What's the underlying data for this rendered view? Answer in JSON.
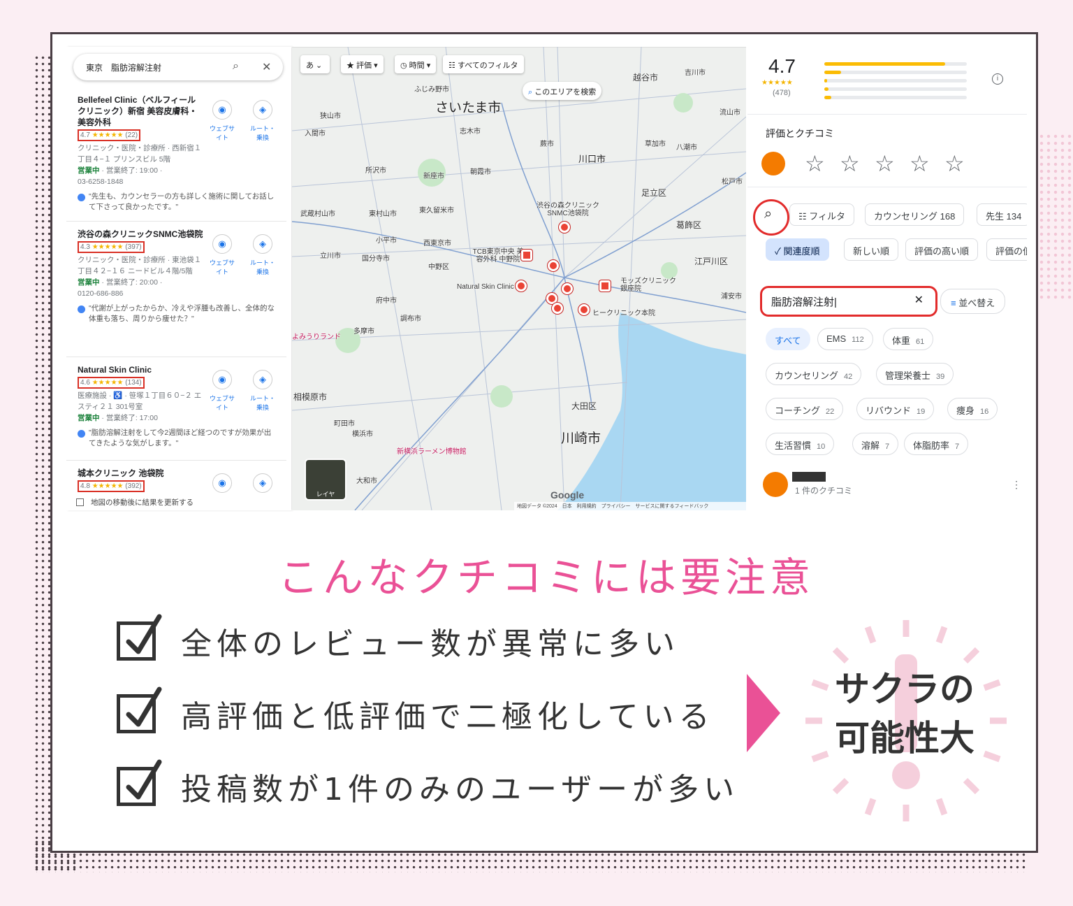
{
  "screenshot": {
    "left_panel": {
      "search_text": "東京　脂肪溶解注射",
      "website_label": "ウェブサイト",
      "route_label": "ルート・乗換",
      "update_label": "地図の移動後に結果を更新する",
      "places": [
        {
          "name": "Bellefeel Clinic（ベルフィールクリニック）新宿 美容皮膚科・美容外科",
          "rating": "4.7",
          "stars": "★★★★★",
          "reviews": "(22)",
          "line1": "クリニック・医院・診療所 · 西新宿１丁目４−１ プリンスビル 5階",
          "open": "営業中",
          "hours": " · 営業終了: 19:00 ·",
          "phone": "03-6258-1848",
          "review": "\"先生も、カウンセラーの方も詳しく施術に関してお話して下さって良かったです。\""
        },
        {
          "name": "渋谷の森クリニックSNMC池袋院",
          "rating": "4.3",
          "stars": "★★★★★",
          "reviews": "(397)",
          "line1": "クリニック・医院・診療所 · 東池袋１丁目４２−１６ ニードビル４階/5階",
          "open": "営業中",
          "hours": " · 営業終了: 20:00 ·",
          "phone": "0120-686-886",
          "review": "\"代謝が上がったからか、冷えや浮腫も改善し、全体的な体重も落ち、周りから痩せた？\""
        },
        {
          "name": "Natural Skin Clinic",
          "rating": "4.6",
          "stars": "★★★★★",
          "reviews": "(134)",
          "line1": "医療施設 · ♿ · 笹塚１丁目６０−２ エスティ２１ 301号室",
          "open": "営業中",
          "hours": " · 営業終了: 17:00",
          "phone": "",
          "review": "\"脂肪溶解注射をして今2週間ほど経つのですが効果が出てきたような気がします。\""
        },
        {
          "name": "城本クリニック 池袋院",
          "rating": "4.8",
          "stars": "★★★★★",
          "reviews": "(392)",
          "line1": "",
          "open": "",
          "hours": "",
          "phone": "",
          "review": ""
        }
      ]
    },
    "map": {
      "chips": {
        "lang": "あ",
        "rating": "★ 評価",
        "time": "◷ 時間",
        "filters": "すべてのフィルタ",
        "search_area": "このエリアを検索"
      },
      "labels": {
        "saitama": "さいたま市",
        "kawaguchi": "川口市",
        "kawasaki": "川崎市",
        "sagamihara": "相模原市",
        "fujimino": "ふじみ野市",
        "koshigaya": "越谷市",
        "yoshikawa": "吉川市",
        "sayama": "狭山市",
        "shiki": "志木市",
        "iruma": "入間市",
        "warabi": "蕨市",
        "soka": "草加市",
        "yashio": "八潮市",
        "tokorozawa": "所沢市",
        "niiza": "新座市",
        "asaka": "朝霞市",
        "nagareyama": "流山市",
        "matsudo": "松戸市",
        "adachi": "足立区",
        "musashimurayama": "武蔵村山市",
        "higashiyamato": "東村山市",
        "higashikurume": "東久留米市",
        "shibuya_mori": "渋谷の森クリニック SNMC池袋院",
        "katsushika": "葛飾区",
        "kodaira": "小平市",
        "nishitokyo": "西東京市",
        "tachikawa": "立川市",
        "kokubunji": "国分寺市",
        "nakano": "中野区",
        "tcb": "TCB東京中央 美容外科 中野院",
        "edogawa": "江戸川区",
        "natural": "Natural Skin Clinic",
        "moss": "モッズクリニック 銀座院",
        "fuchu": "府中市",
        "chofu": "調布市",
        "yomiuri": "よみうりランド",
        "tama": "多摩市",
        "hi": "ヒークリニック本院",
        "urayasu": "浦安市",
        "machida": "町田市",
        "yokohama": "横浜市",
        "ota": "大田区",
        "shinyokohama": "新横浜ラーメン博物館",
        "yamato": "大和市"
      },
      "layer_label": "レイヤ",
      "google": "Google",
      "footer": "地図データ ©2024　日本　利用規約　プライバシー　サービスに関するフィードバック"
    },
    "right_panel": {
      "rating": "4.7",
      "stars": "★★★★★",
      "count": "(478)",
      "distribution": [
        0.85,
        0.12,
        0.02,
        0.03,
        0.05
      ],
      "section_title": "評価とクチコミ",
      "empty_stars": [
        "☆",
        "☆",
        "☆",
        "☆",
        "☆"
      ],
      "filter_pills": [
        "フィルタ",
        "カウンセリング 168",
        "先生 134"
      ],
      "sort_pills": [
        "関連度順",
        "新しい順",
        "評価の高い順",
        "評価の低"
      ],
      "search_value": "脂肪溶解注射",
      "sort_button": "並べ替え",
      "tags": [
        {
          "label": "すべて",
          "n": ""
        },
        {
          "label": "EMS",
          "n": "112"
        },
        {
          "label": "体重",
          "n": "61"
        },
        {
          "label": "カウンセリング",
          "n": "42"
        },
        {
          "label": "管理栄養士",
          "n": "39"
        },
        {
          "label": "コーチング",
          "n": "22"
        },
        {
          "label": "リバウンド",
          "n": "19"
        },
        {
          "label": "痩身",
          "n": "16"
        },
        {
          "label": "生活習慣",
          "n": "10"
        },
        {
          "label": "溶解",
          "n": "7"
        },
        {
          "label": "体脂肪率",
          "n": "7"
        }
      ],
      "reviewer_sub": "1 件のクチコミ"
    }
  },
  "infographic": {
    "headline": "こんなクチコミには要注意",
    "items": [
      "全体のレビュー数が異常に多い",
      "高評価と低評価で二極化している",
      "投稿数が1件のみのユーザーが多い"
    ],
    "conclusion_line1": "サクラの",
    "conclusion_line2": "可能性大"
  },
  "colors": {
    "accent_pink": "#ea5196",
    "background": "#fbeef3",
    "highlight_red": "#e22b2b",
    "map_pin": "#ea4335"
  }
}
